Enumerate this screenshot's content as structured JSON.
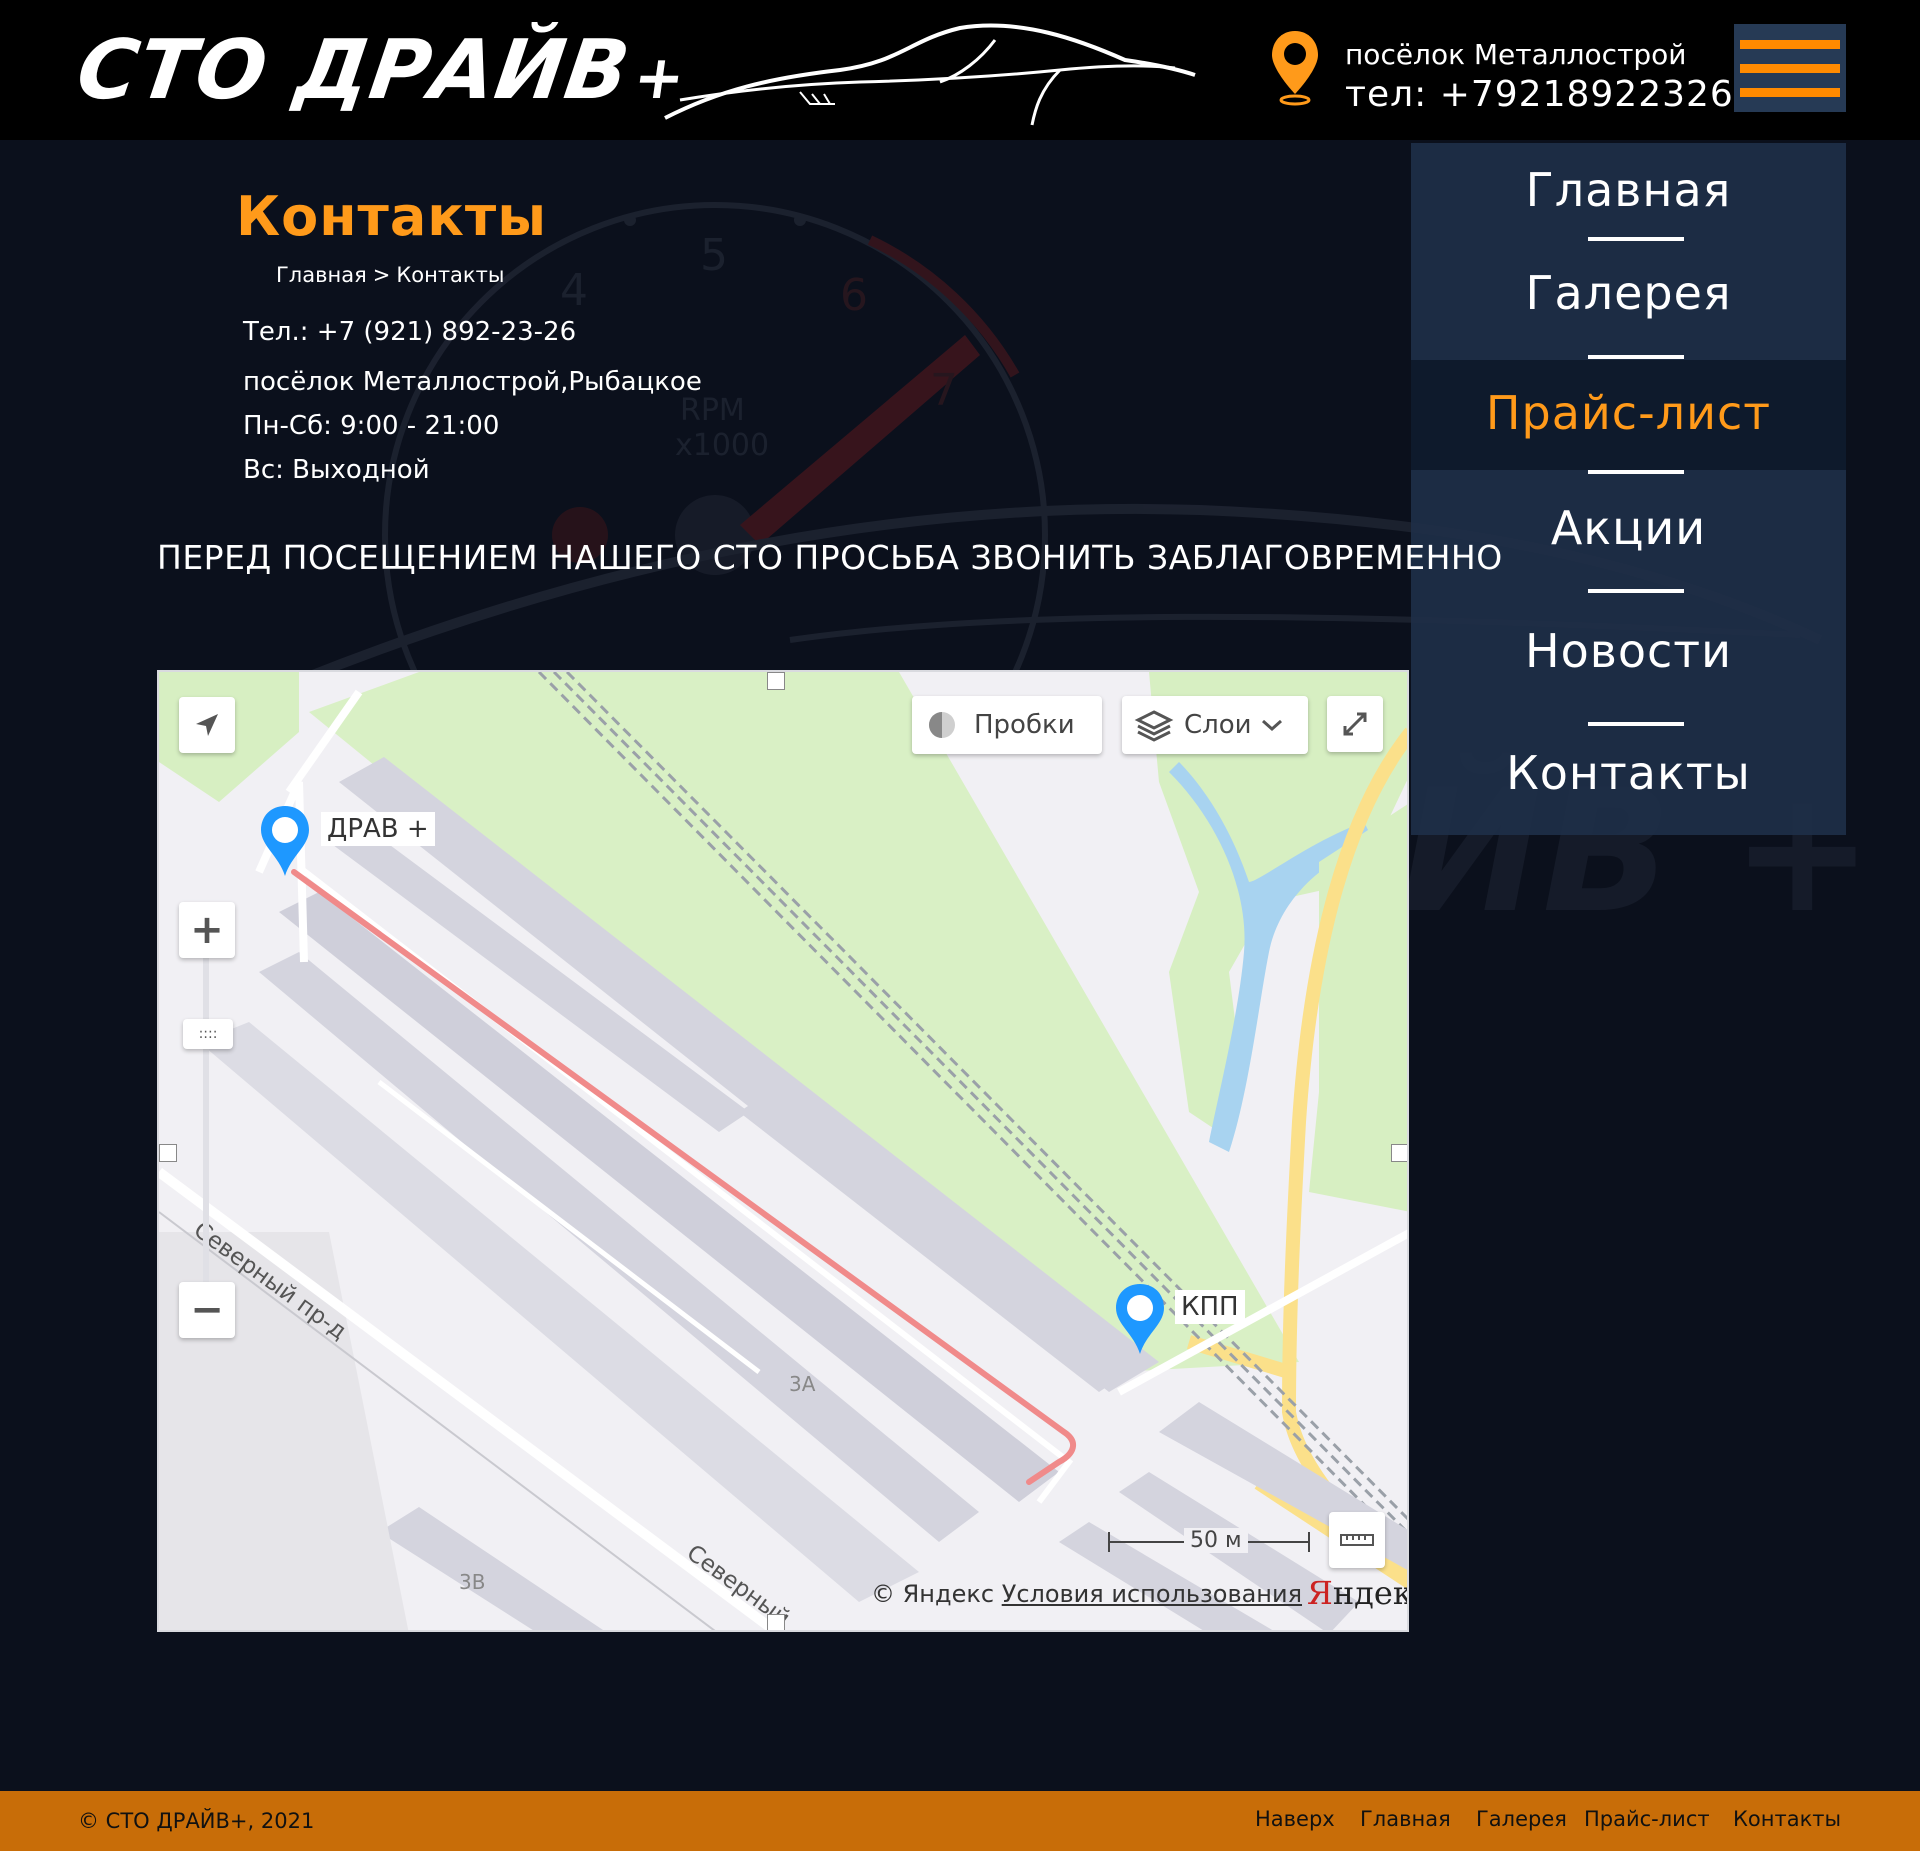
{
  "header": {
    "logo_main": "СТО ДРАЙВ",
    "logo_plus": "+",
    "address": "посёлок Металлострой",
    "phone": "тел: +79218922326",
    "icons": {
      "location": "location-pin-icon",
      "menu": "hamburger-menu-icon"
    },
    "accent_color": "#ff8a00"
  },
  "menu": {
    "items": [
      {
        "label": "Главная",
        "active": false
      },
      {
        "label": "Галерея",
        "active": false
      },
      {
        "label": "Прайс-лист",
        "active": true
      },
      {
        "label": "Акции",
        "active": false
      },
      {
        "label": "Новости",
        "active": false
      },
      {
        "label": "Контакты",
        "active": false
      }
    ]
  },
  "content": {
    "title": "Контакты",
    "breadcrumb": {
      "home": "Главная",
      "separator": ">",
      "current": "Контакты"
    },
    "phone": "Тел.: +7 (921) 892-23-26",
    "address": "посёлок Металлострой,Рыбацкое",
    "hours_weekdays": "Пн-Сб: 9:00 - 21:00",
    "hours_sunday": "Вс: Выходной",
    "notice": "ПЕРЕД ПОСЕЩЕНИЕМ НАШЕГО СТО ПРОСЬБА ЗВОНИТЬ ЗАБЛАГОВРЕМЕННО"
  },
  "map": {
    "traffic_button": "Пробки",
    "layers_button": "Слои",
    "zoom_in": "+",
    "zoom_out": "−",
    "marker_start": "ДРАВ +",
    "marker_end": "КПП",
    "street_label_1": "Северный пр-д",
    "street_label_2": "Северный",
    "building_3a": "3А",
    "building_3v": "3В",
    "scale": "50 м",
    "copyright": "© Яндекс",
    "terms": "Условия использования",
    "yandex_logo_first": "Я",
    "yandex_logo_rest": "ндекс",
    "icons": {
      "locate": "geolocation-arrow-icon",
      "traffic": "traffic-icon",
      "layers": "layers-icon",
      "fullscreen": "fullscreen-icon",
      "ruler": "ruler-icon"
    },
    "route_color": "#f08a8a"
  },
  "footer": {
    "copyright": "© СТО ДРАЙВ+, 2021",
    "links": [
      "Наверх",
      "Главная",
      "Галерея",
      "Прайс-лист",
      "Контакты"
    ],
    "background_color": "#c86d08"
  }
}
